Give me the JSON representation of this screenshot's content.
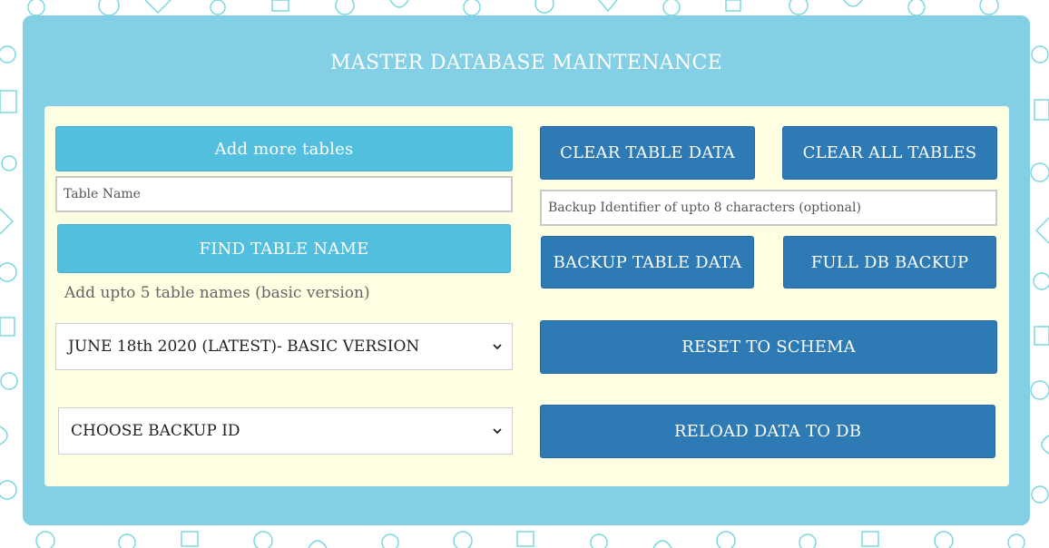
{
  "header": {
    "title": "MASTER DATABASE MAINTENANCE"
  },
  "left": {
    "add_tables_label": "Add more tables",
    "table_name_placeholder": "Table Name",
    "find_table_label": "FIND TABLE NAME",
    "hint": "Add upto 5 table names (basic version)",
    "version_select": {
      "selected": "JUNE 18th 2020 (LATEST)- BASIC VERSION"
    },
    "backup_select": {
      "selected": "CHOOSE BACKUP ID"
    }
  },
  "right": {
    "clear_table_label": "CLEAR TABLE DATA",
    "clear_all_label": "CLEAR ALL TABLES",
    "backup_id_placeholder": "Backup Identifier of upto 8 characters (optional)",
    "backup_table_label": "BACKUP TABLE DATA",
    "full_backup_label": "FULL DB BACKUP",
    "reset_schema_label": "RESET TO SCHEMA",
    "reload_label": "RELOAD DATA TO DB"
  },
  "icons": {
    "background": "finance-pattern-icons",
    "dropdown": "chevron-down-icon"
  },
  "colors": {
    "panel": "#82cfe6",
    "inner": "#fefee2",
    "light_button": "#52bfdf",
    "dark_button": "#2e7ab5",
    "pattern": "#3cc6cf"
  }
}
